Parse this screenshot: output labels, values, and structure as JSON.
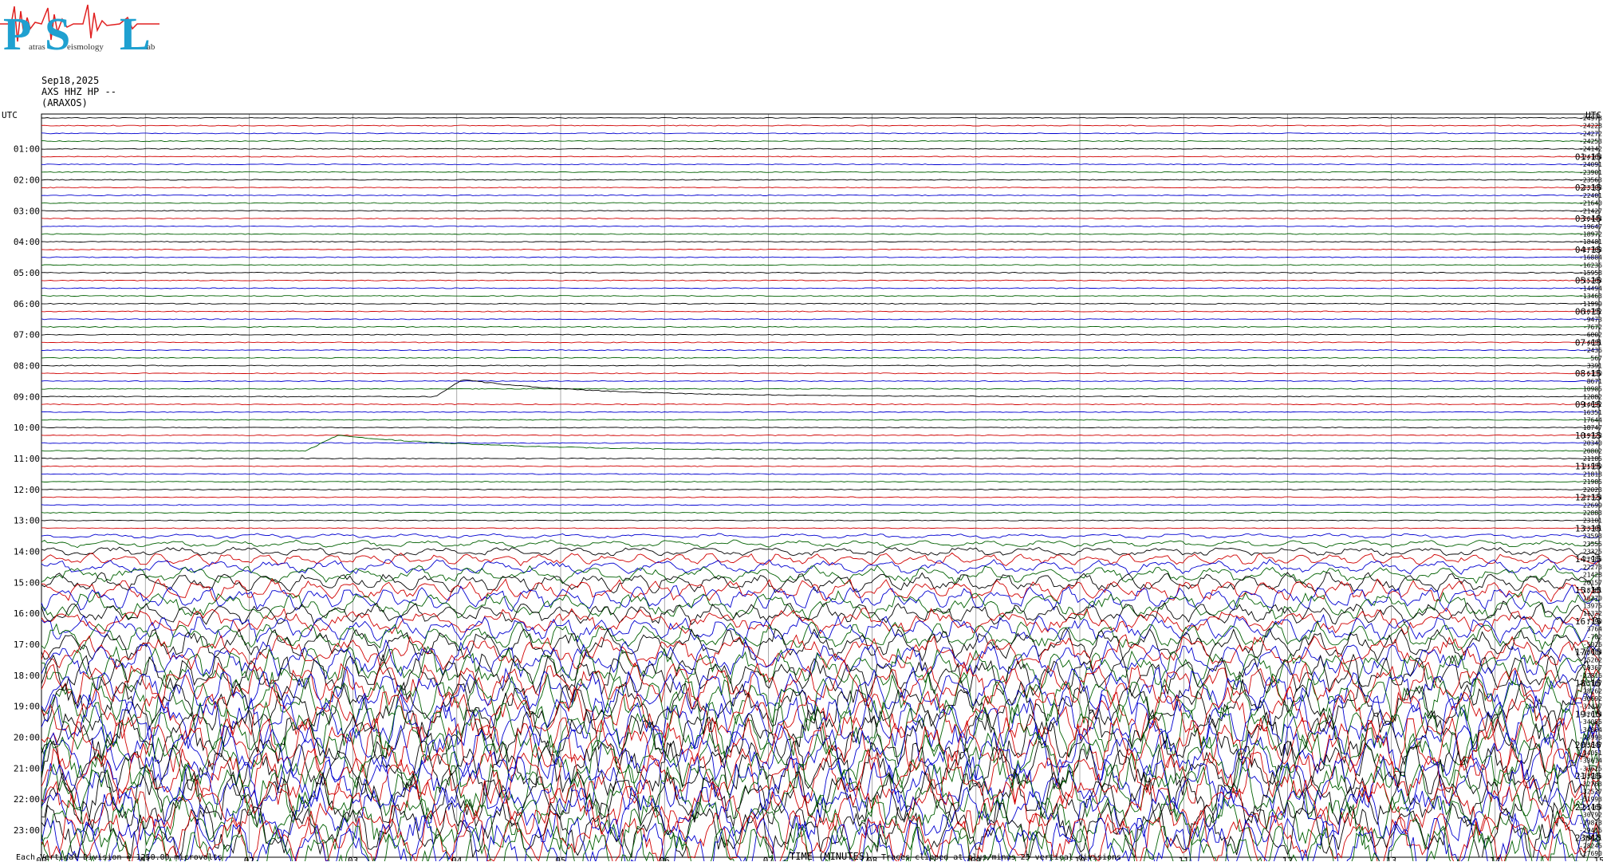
{
  "header": {
    "date": "Sep18,2025",
    "station": "AXS HHZ HP --",
    "location": "(ARAXOS)"
  },
  "logo": {
    "letters": [
      "P",
      "S",
      "L"
    ],
    "words": [
      "atras",
      "eismology",
      "ab"
    ],
    "colors": {
      "letters": "#1fa0d0",
      "wave": "#e02020"
    }
  },
  "colors": {
    "traces": [
      "#000000",
      "#d00000",
      "#0000d0",
      "#006000"
    ],
    "grid": "#000000",
    "frame": "#000000"
  },
  "chart_data": {
    "type": "line",
    "title": "",
    "subtitle": "",
    "xlabel": "TIME (MINUTES)",
    "ylabel": "UTC",
    "right_axis_label": "UTC",
    "xlim": [
      0,
      15
    ],
    "x_ticks": [
      "00",
      "01",
      "02",
      "03",
      "04",
      "05",
      "06",
      "07",
      "08",
      "09",
      "10",
      "11",
      "12",
      "13",
      "14",
      "15"
    ],
    "left_hour_ticks": [
      "01:00",
      "02:00",
      "03:00",
      "04:00",
      "05:00",
      "06:00",
      "07:00",
      "08:00",
      "09:00",
      "10:00",
      "11:00",
      "12:00",
      "13:00",
      "14:00",
      "15:00",
      "16:00",
      "17:00",
      "18:00",
      "19:00",
      "20:00",
      "21:00",
      "22:00",
      "23:00"
    ],
    "right_hour_ticks": [
      "01:15",
      "02:15",
      "03:15",
      "04:15",
      "05:15",
      "06:15",
      "07:15",
      "08:15",
      "09:15",
      "10:15",
      "11:15",
      "12:15",
      "13:15",
      "14:15",
      "15:15",
      "16:15",
      "17:15",
      "18:15",
      "19:15",
      "20:15",
      "21:15",
      "22:15",
      "23:15"
    ],
    "trace_count": 96,
    "trace_interval_minutes": 15,
    "trace_colors_cycle": [
      "black",
      "red",
      "blue",
      "green"
    ],
    "offset_values": [
      -24978,
      -24228,
      -24272,
      -24253,
      -24142,
      -24164,
      -24091,
      -23901,
      -23563,
      -23308,
      -22401,
      -21640,
      -21427,
      -20444,
      -19647,
      -18972,
      -18481,
      -17708,
      -16884,
      -16236,
      -15958,
      -15263,
      -14494,
      -13463,
      -11999,
      -10752,
      -9473,
      -7672,
      -6002,
      -4651,
      -2436,
      567,
      3391,
      6130,
      8671,
      10985,
      12882,
      14652,
      16351,
      17644,
      18747,
      19728,
      20340,
      20802,
      21185,
      21550,
      21818,
      21985,
      22023,
      22324,
      22699,
      22883,
      23101,
      23301,
      23593,
      23555,
      23325,
      22986,
      22273,
      21428,
      20157,
      18381,
      16270,
      13975,
      11332,
      7790,
      3764,
      -702,
      -5026,
      -10684,
      -15262,
      -19367,
      -22816,
      -25707,
      -28262,
      -30692,
      -31437,
      -32614,
      -34055,
      -34864,
      -33993,
      -33847,
      -34051,
      -33614,
      -33625,
      -33286,
      -32763,
      -32537,
      -31993,
      -31468,
      -30792,
      -29873,
      -29416,
      -29021,
      -28245,
      -27690
    ],
    "features": [
      {
        "trace_hour": "09:00",
        "type": "long-period excursion",
        "start_min": 3.8,
        "peak_min": 4.05
      },
      {
        "trace_hour": "10:45",
        "type": "long-period excursion",
        "start_min": 2.55,
        "peak_min": 2.85
      },
      {
        "from_hour": "13:45",
        "description": "large-amplitude oscillations, clipped traces"
      }
    ],
    "annotations": {
      "scale": "Each Vertical Division = 1250.00 microvolts",
      "clip": "Traces clipped at plus/minus 25 vertical divisions"
    },
    "grid": true
  }
}
